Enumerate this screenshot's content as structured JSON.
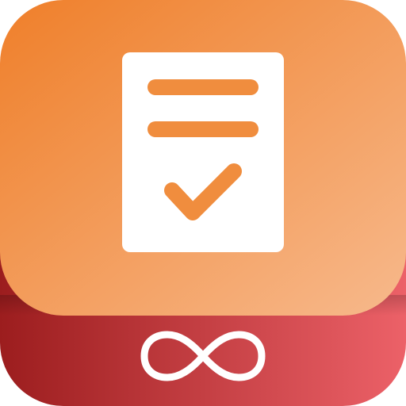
{
  "app_icon": {
    "icons": {
      "document": "document-icon",
      "checkmark": "checkmark-icon",
      "infinity_logo": "infinity-logo-icon"
    },
    "colors": {
      "top_gradient_start": "#ef7f2a",
      "top_gradient_end": "#f7b98c",
      "base_gradient_start": "#9c1d1e",
      "base_gradient_end": "#ec6168",
      "document_fill": "#ffffff",
      "document_lines": "#f08d3e",
      "logo_stroke": "#ffffff"
    }
  }
}
